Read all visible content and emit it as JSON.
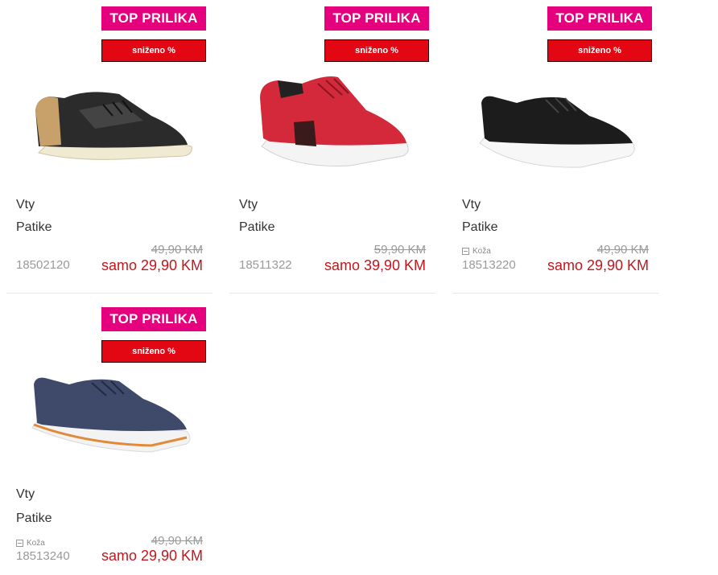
{
  "colors": {
    "top_badge": "#e5007d",
    "sale_badge": "#e30613",
    "new_price": "#c4161c"
  },
  "products": [
    {
      "top_badge": "TOP PRILIKA",
      "sale_badge": "sniženo %",
      "brand": "Vty",
      "category": "Patike",
      "material": "",
      "sku": "18502120",
      "old_price": "49,90 KM",
      "new_price": "samo 29,90 KM",
      "image": "black-sneaker-tan-heel"
    },
    {
      "top_badge": "TOP PRILIKA",
      "sale_badge": "sniženo %",
      "brand": "Vty",
      "category": "Patike",
      "material": "",
      "sku": "18511322",
      "old_price": "59,90 KM",
      "new_price": "samo 39,90 KM",
      "image": "red-knit-sneaker"
    },
    {
      "top_badge": "TOP PRILIKA",
      "sale_badge": "sniženo %",
      "brand": "Vty",
      "category": "Patike",
      "material": "Koža",
      "sku": "18513220",
      "old_price": "49,90 KM",
      "new_price": "samo 29,90 KM",
      "image": "black-knit-sneaker"
    },
    {
      "top_badge": "TOP PRILIKA",
      "sale_badge": "sniženo %",
      "brand": "Vty",
      "category": "Patike",
      "material": "Koža",
      "sku": "18513240",
      "old_price": "49,90 KM",
      "new_price": "samo 29,90 KM",
      "image": "navy-knit-sneaker"
    }
  ]
}
